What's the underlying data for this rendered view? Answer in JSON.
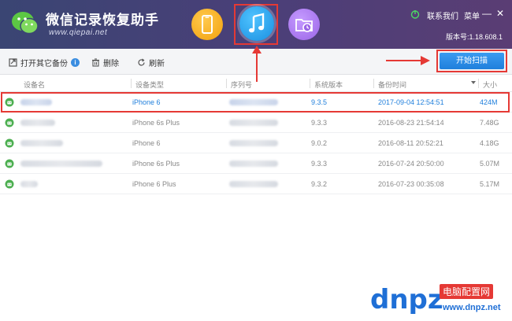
{
  "header": {
    "title": "微信记录恢复助手",
    "url": "www.qiepai.net",
    "contact": "联系我们",
    "menu": "菜单",
    "minimize": "—",
    "close": "✕",
    "version": "版本号:1.18.608.1",
    "modes": [
      {
        "icon": "phone-icon",
        "color": "#f5a623"
      },
      {
        "icon": "music-note-icon",
        "color": "#2196f3",
        "active": true
      },
      {
        "icon": "folder-clock-icon",
        "color": "#a779f0"
      }
    ]
  },
  "toolbar": {
    "open_backup": "打开其它备份",
    "delete": "删除",
    "refresh": "刷新",
    "start_scan": "开始扫描"
  },
  "table": {
    "columns": [
      "设备名",
      "设备类型",
      "序列号",
      "系统版本",
      "备份时间",
      "大小"
    ],
    "rows": [
      {
        "type": "iPhone 6",
        "version": "9.3.5",
        "time": "2017-09-04 12:54:51",
        "size": "424M",
        "selected": true
      },
      {
        "type": "iPhone 6s Plus",
        "version": "9.3.3",
        "time": "2016-08-23 21:54:14",
        "size": "7.48G",
        "selected": false
      },
      {
        "type": "iPhone 6",
        "version": "9.0.2",
        "time": "2016-08-11 20:52:21",
        "size": "4.18G",
        "selected": false
      },
      {
        "type": "iPhone 6s Plus",
        "version": "9.3.3",
        "time": "2016-07-24 20:50:00",
        "size": "5.07M",
        "selected": false
      },
      {
        "type": "iPhone 6 Plus",
        "version": "9.3.2",
        "time": "2016-07-23 00:35:08",
        "size": "5.17M",
        "selected": false
      }
    ]
  },
  "watermark": {
    "logo": "dnpz",
    "brand": "电脑配置网",
    "url": "www.dnpz.net"
  },
  "colors": {
    "accent": "#1f7fdc",
    "highlight": "#e53935",
    "header_bg": "#443f75"
  }
}
